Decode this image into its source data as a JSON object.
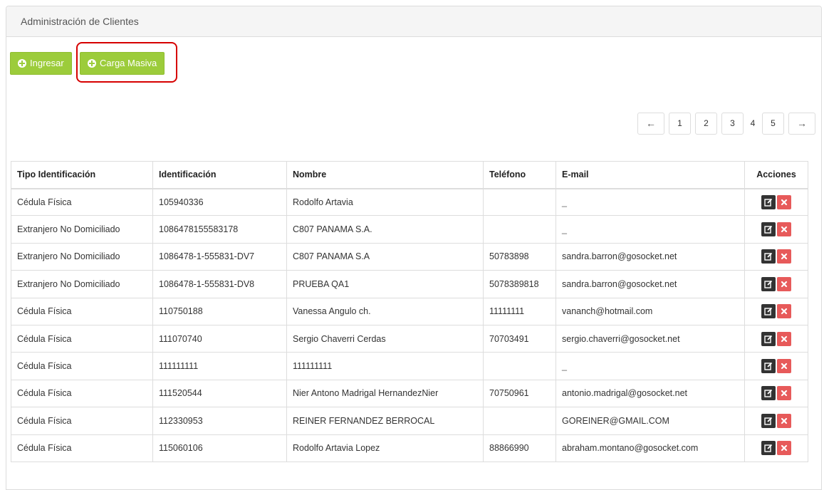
{
  "panel": {
    "title": "Administración de Clientes"
  },
  "toolbar": {
    "ingresar_label": "Ingresar",
    "carga_masiva_label": "Carga Masiva"
  },
  "pagination": {
    "prev": "←",
    "pages": [
      "1",
      "2",
      "3",
      "4",
      "5"
    ],
    "next": "→"
  },
  "table": {
    "headers": [
      "Tipo Identificación",
      "Identificación",
      "Nombre",
      "Teléfono",
      "E-mail",
      "Acciones"
    ],
    "rows": [
      [
        "Cédula Física",
        "105940336",
        "Rodolfo Artavia",
        "",
        "_"
      ],
      [
        "Extranjero No Domiciliado",
        "1086478155583178",
        "C807 PANAMA S.A.",
        "",
        "_"
      ],
      [
        "Extranjero No Domiciliado",
        "1086478-1-555831-DV7",
        "C807 PANAMA S.A",
        "50783898",
        "sandra.barron@gosocket.net"
      ],
      [
        "Extranjero No Domiciliado",
        "1086478-1-555831-DV8",
        "PRUEBA QA1",
        "5078389818",
        "sandra.barron@gosocket.net"
      ],
      [
        "Cédula Física",
        "110750188",
        "Vanessa Angulo ch.",
        "11111111",
        "vananch@hotmail.com"
      ],
      [
        "Cédula Física",
        "111070740",
        "Sergio Chaverri Cerdas",
        "70703491",
        "sergio.chaverri@gosocket.net"
      ],
      [
        "Cédula Física",
        "111111111",
        "111111111",
        "",
        "_"
      ],
      [
        "Cédula Física",
        "111520544",
        "Nier Antono Madrigal HernandezNier",
        "70750961",
        "antonio.madrigal@gosocket.net"
      ],
      [
        "Cédula Física",
        "112330953",
        "REINER FERNANDEZ BERROCAL",
        "",
        "GOREINER@GMAIL.COM"
      ],
      [
        "Cédula Física",
        "115060106",
        "Rodolfo Artavia Lopez",
        "88866990",
        "abraham.montano@gosocket.com"
      ]
    ]
  },
  "icons": {
    "ingresar": "plus-circle-icon",
    "carga_masiva": "plus-circle-icon",
    "edit": "edit-icon",
    "delete": "close-icon"
  },
  "colors": {
    "button_green": "#9ccc3b",
    "highlight": "#d60000",
    "edit_btn": "#333333",
    "delete_btn": "#e75a5a"
  }
}
